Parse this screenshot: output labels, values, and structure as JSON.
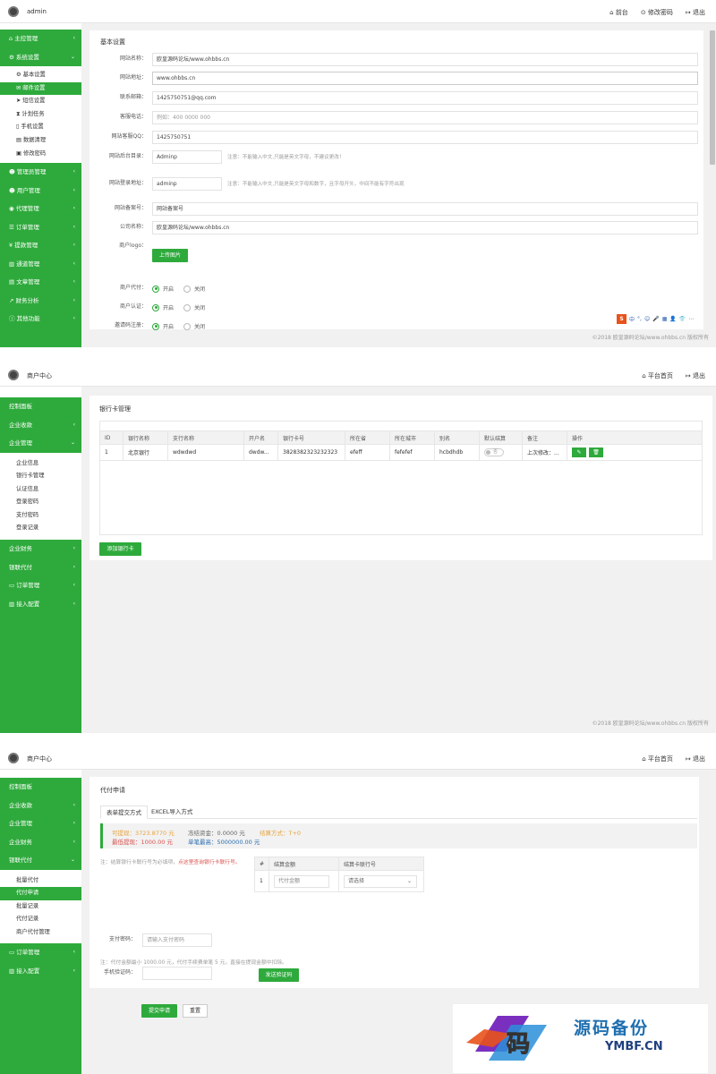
{
  "p1": {
    "brand": "admin",
    "top_links": [
      "前台",
      "修改密码",
      "退出"
    ],
    "menu_top": [
      "主控管理",
      "系统设置"
    ],
    "submenu": [
      "基本设置",
      "邮件设置",
      "短信设置",
      "计划任务",
      "手机设置",
      "数据清理",
      "修改密码"
    ],
    "submenu_active": 1,
    "menu_bottom": [
      "管理员管理",
      "用户管理",
      "代理管理",
      "订单管理",
      "提款管理",
      "通道管理",
      "文章管理",
      "财务分析",
      "其他功能"
    ],
    "card_title": "基本设置",
    "fields": [
      {
        "label": "网站名称：",
        "value": "欧皇源码论坛/www.ohbbs.cn"
      },
      {
        "label": "网站地址：",
        "value": "www.ohbbs.cn"
      },
      {
        "label": "联系邮箱：",
        "value": "1425750751@qq.com"
      },
      {
        "label": "客服电话：",
        "value": "例如：400 0000 000"
      },
      {
        "label": "网站客服QQ：",
        "value": "1425750751"
      }
    ],
    "admin_dir": {
      "label": "网站后台目录：",
      "value": "Adminp",
      "note": "注意：不能输入中文,只能是英文字母，不建议更改！"
    },
    "login_dir": {
      "label": "网站登录地址：",
      "value": "adminp",
      "note": "注意：不能输入中文,只能是英文字母和数字，且字母开头，中间不能有字符出现"
    },
    "icp": {
      "label": "网站备案号：",
      "value": "网站备案号"
    },
    "company": {
      "label": "公司名称：",
      "value": "欧皇源码论坛/www.ohbbs.cn"
    },
    "logo_label": "商户logo：",
    "upload_label": "上传图片",
    "radios": [
      {
        "label": "商户代付：",
        "on": "开启",
        "off": "关闭"
      },
      {
        "label": "商户认证：",
        "on": "开启",
        "off": "关闭"
      },
      {
        "label": "邀请码注册：",
        "on": "开启",
        "off": "关闭"
      }
    ],
    "ime": [
      "中",
      "°,",
      "☺",
      "🎤",
      "▦",
      "👤",
      "👕",
      "⋯"
    ],
    "footer": "©2018 欧皇源码论坛/www.ohbbs.cn 版权所有"
  },
  "p2": {
    "brand": "商户中心",
    "top_links": [
      "平台首页",
      "退出"
    ],
    "menu_top": [
      "控制面板",
      "企业收款",
      "企业管理"
    ],
    "submenu": [
      "企业信息",
      "银行卡管理",
      "认证信息",
      "登录密码",
      "支付密码",
      "登录记录"
    ],
    "menu_bottom": [
      "企业财务",
      "银联代付",
      "订单管理",
      "接入配置"
    ],
    "card_title": "银行卡管理",
    "columns": [
      "ID",
      "银行名称",
      "支行名称",
      "开户名",
      "银行卡号",
      "所在省",
      "所在城市",
      "别名",
      "默认结算",
      "备注",
      "操作"
    ],
    "rows": [
      [
        "1",
        "北京银行",
        "wdwdwd",
        "dwdw...",
        "3828382323232323",
        "efeff",
        "fefefef",
        "hcbdhdb",
        "否",
        "上次修改：..."
      ]
    ],
    "add_button": "添加银行卡",
    "footer": "©2018 欧皇源码论坛/www.ohbbs.cn 版权所有"
  },
  "p3": {
    "brand": "商户中心",
    "top_links": [
      "平台首页",
      "退出"
    ],
    "menu_top": [
      "控制面板",
      "企业收款",
      "企业管理",
      "企业财务",
      "银联代付"
    ],
    "submenu": [
      "批量代付",
      "代付申请",
      "批量记录",
      "代付记录",
      "商户代付管理"
    ],
    "submenu_active": 1,
    "menu_bottom": [
      "订单管理",
      "接入配置"
    ],
    "card_title": "代付申请",
    "tabs": [
      "表单提交方式",
      "EXCEL导入方式"
    ],
    "info": {
      "available": "可提现：3723.8770 元",
      "frozen": "冻结资金：0.0000 元",
      "settle": "结算方式：T+0",
      "min": "最低提现：1000.00 元",
      "max": "单笔最高：5000000.00 元"
    },
    "note1_a": "注：结算银行卡联行号为必填项，",
    "note1_b": "点这里查询银行卡联行号。",
    "mini_columns": [
      "#",
      "结算金额",
      "结算卡联行号"
    ],
    "mini_row": {
      "no": "1",
      "amount_ph": "代付金额",
      "select": "请选择"
    },
    "pay_pwd": {
      "label": "支付密码：",
      "placeholder": "请输入支付密码"
    },
    "note2": "注：代付金额最小 1000.00 元，代付手续费单笔 5 元，直接在提现金额中扣除。",
    "sms": {
      "label": "手机验证码：",
      "button": "发送验证码"
    },
    "submit": "提交申请",
    "reset": "重置",
    "watermark": {
      "big": "源码备份",
      "small": "YMBF.CN",
      "logo": "码"
    }
  }
}
